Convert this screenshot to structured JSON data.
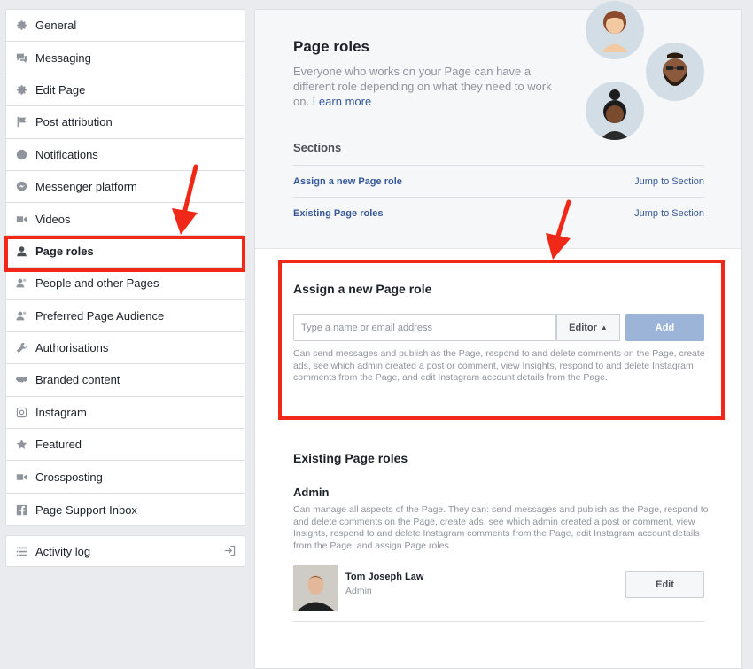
{
  "sidebar": {
    "items": [
      {
        "label": "General",
        "icon": "gear-icon"
      },
      {
        "label": "Messaging",
        "icon": "chat-icon"
      },
      {
        "label": "Edit Page",
        "icon": "gear-icon"
      },
      {
        "label": "Post attribution",
        "icon": "flag-icon"
      },
      {
        "label": "Notifications",
        "icon": "globe-icon"
      },
      {
        "label": "Messenger platform",
        "icon": "messenger-icon"
      },
      {
        "label": "Videos",
        "icon": "video-camera-icon"
      },
      {
        "label": "Page roles",
        "icon": "person-icon",
        "active": true
      },
      {
        "label": "People and other Pages",
        "icon": "people-icon"
      },
      {
        "label": "Preferred Page Audience",
        "icon": "people-icon"
      },
      {
        "label": "Authorisations",
        "icon": "wrench-icon"
      },
      {
        "label": "Branded content",
        "icon": "handshake-icon"
      },
      {
        "label": "Instagram",
        "icon": "instagram-icon"
      },
      {
        "label": "Featured",
        "icon": "star-icon"
      },
      {
        "label": "Crossposting",
        "icon": "video-camera-icon"
      },
      {
        "label": "Page Support Inbox",
        "icon": "facebook-icon"
      }
    ],
    "activity_log": {
      "label": "Activity log",
      "icon": "list-icon",
      "action_icon": "exit-icon"
    }
  },
  "header": {
    "title": "Page roles",
    "intro": "Everyone who works on your Page can have a different role depending on what they need to work on.",
    "learn_more": "Learn more"
  },
  "sections": {
    "heading": "Sections",
    "rows": [
      {
        "label": "Assign a new Page role",
        "jump": "Jump to Section"
      },
      {
        "label": "Existing Page roles",
        "jump": "Jump to Section"
      }
    ]
  },
  "assign": {
    "title": "Assign a new Page role",
    "placeholder": "Type a name or email address",
    "role": "Editor",
    "add_label": "Add",
    "description": "Can send messages and publish as the Page, respond to and delete comments on the Page, create ads, see which admin created a post or comment, view Insights, respond to and delete Instagram comments from the Page, and edit Instagram account details from the Page."
  },
  "existing": {
    "title": "Existing Page roles",
    "admin_heading": "Admin",
    "admin_description": "Can manage all aspects of the Page. They can: send messages and publish as the Page, respond to and delete comments on the Page, create ads, see which admin created a post or comment, view Insights, respond to and delete Instagram comments from the Page, edit Instagram account details from the Page, and assign Page roles.",
    "person": {
      "name": "Tom Joseph Law",
      "role": "Admin"
    },
    "edit_label": "Edit"
  },
  "colors": {
    "highlight": "#f02818",
    "link": "#365899",
    "add_button": "#9cb4d8"
  }
}
